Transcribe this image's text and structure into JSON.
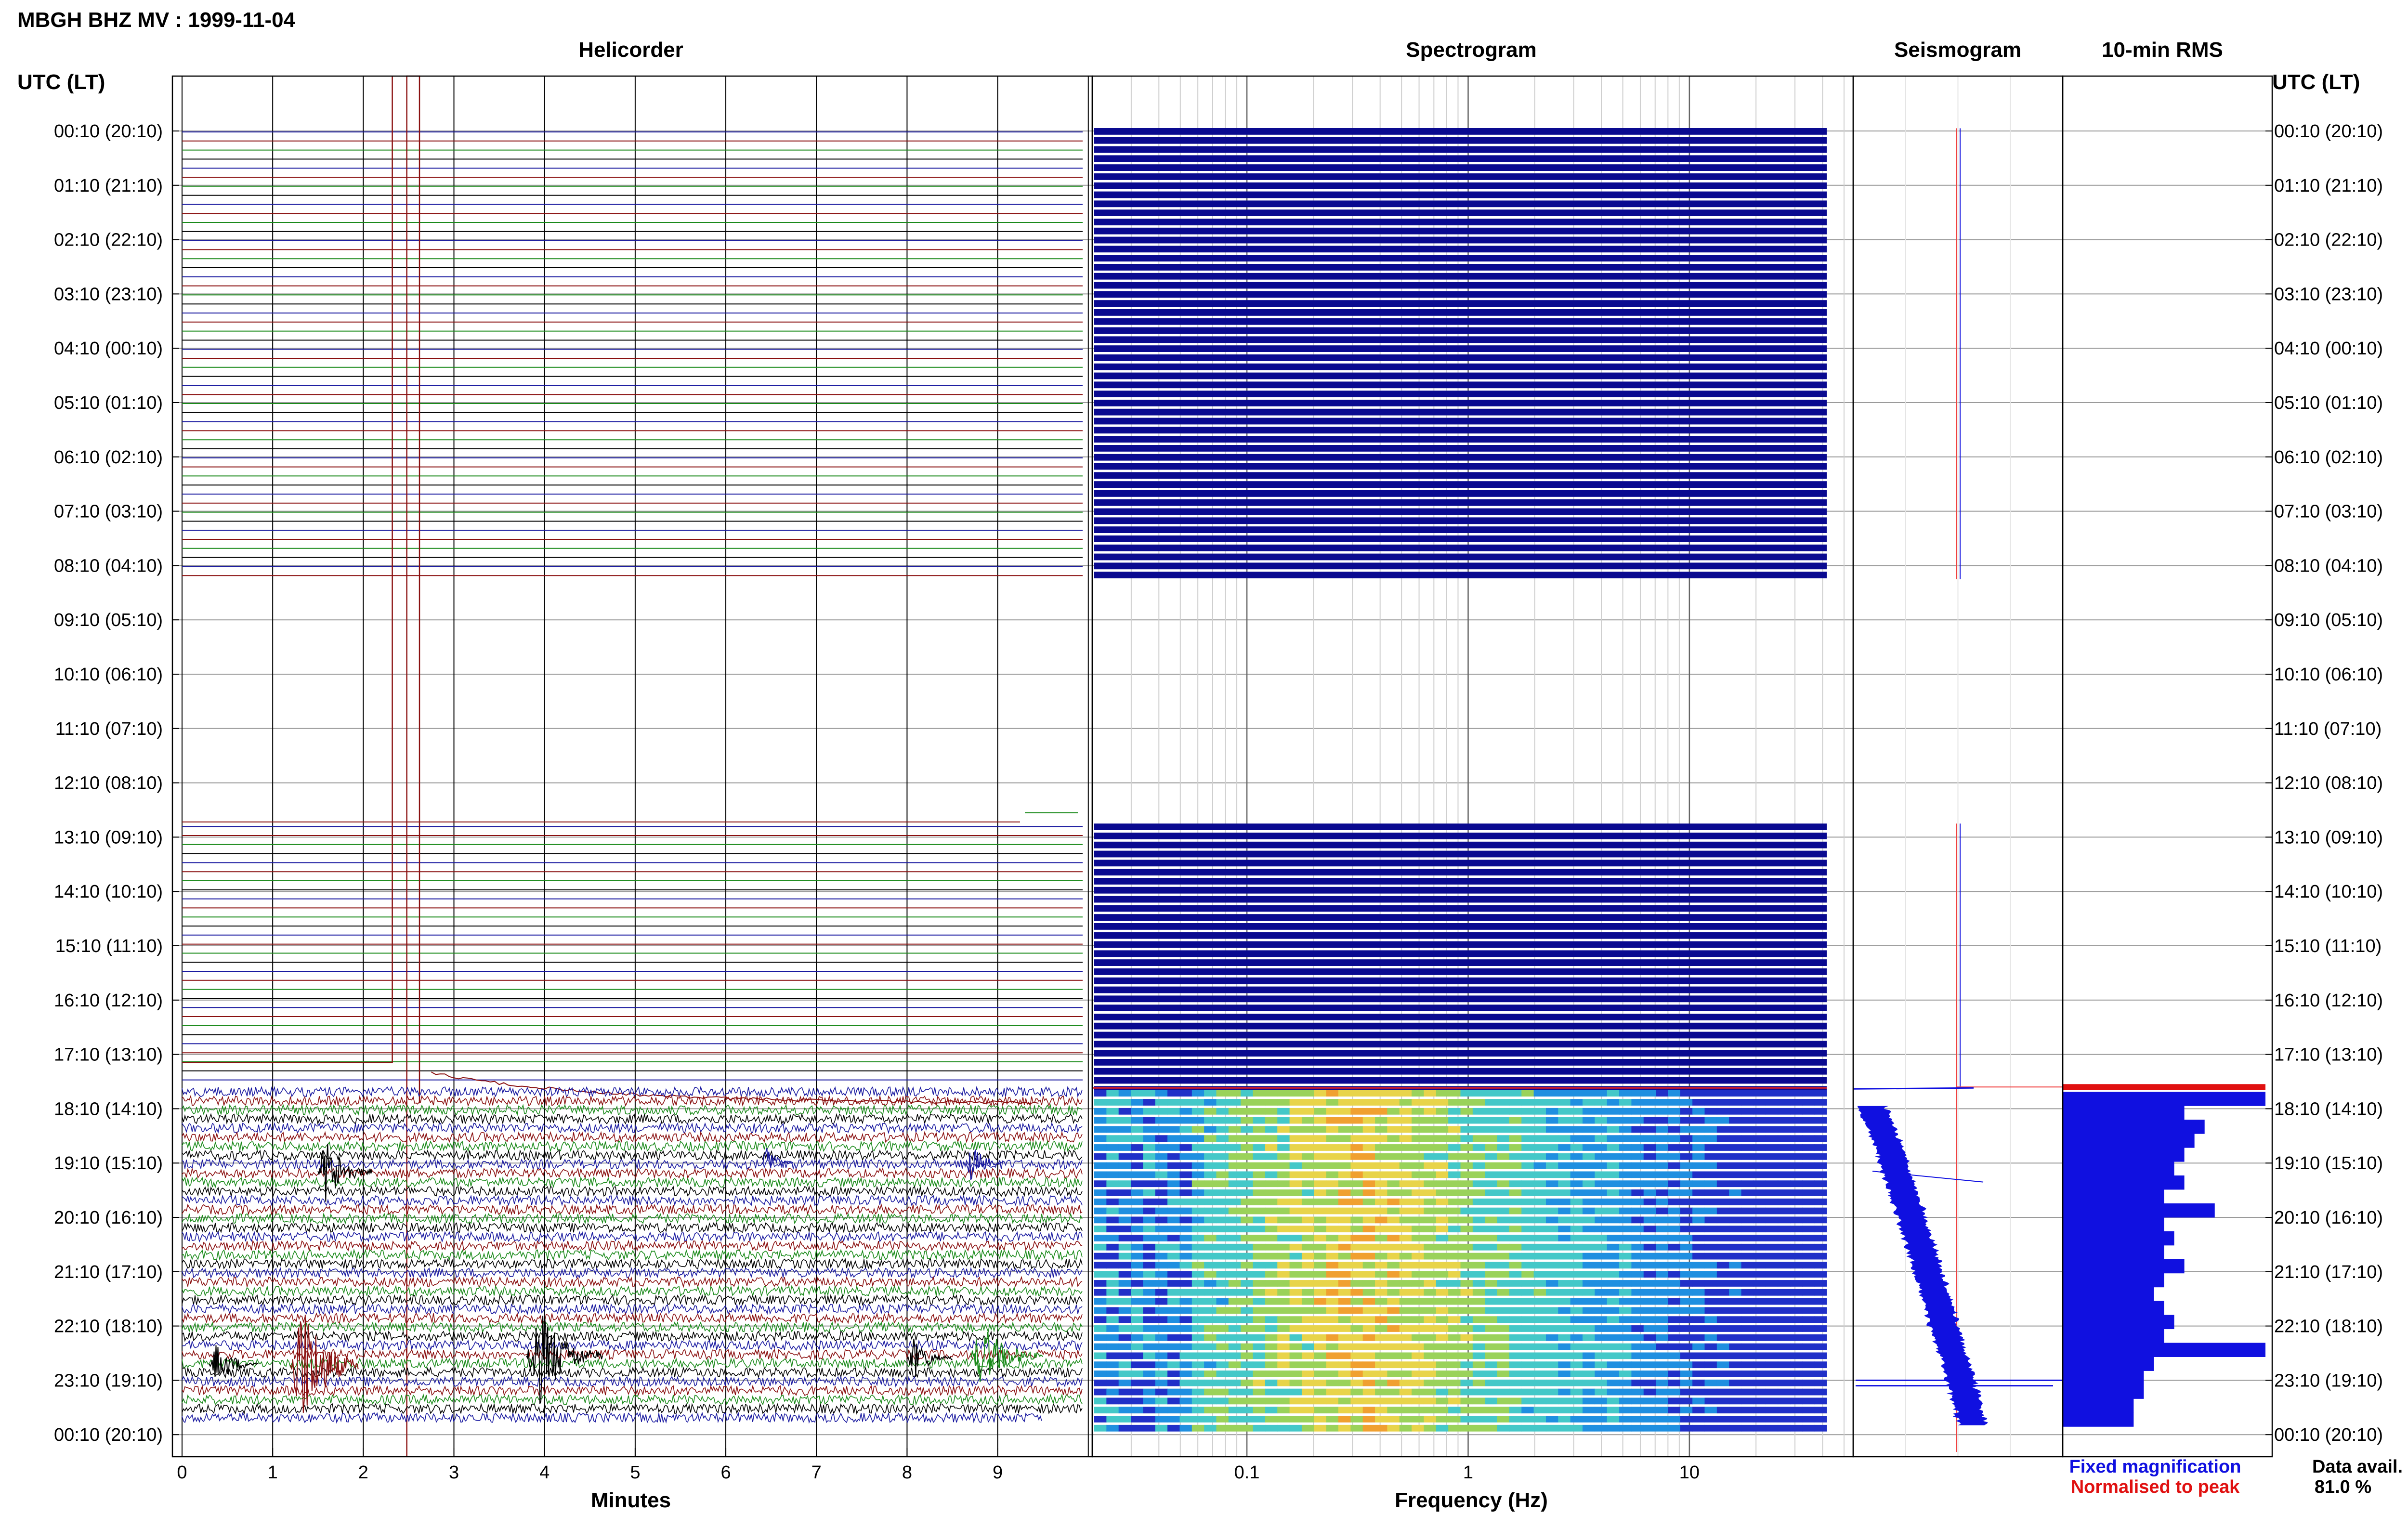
{
  "title": "MBGH BHZ MV : 1999-11-04",
  "panels": {
    "helicorder": "Helicorder",
    "spectrogram": "Spectrogram",
    "seismogram": "Seismogram",
    "rms": "10-min RMS"
  },
  "time_axis_label_left": "UTC (LT)",
  "time_axis_label_right": "UTC (LT)",
  "time_labels": [
    "00:10 (20:10)",
    "01:10 (21:10)",
    "02:10 (22:10)",
    "03:10 (23:10)",
    "04:10 (00:10)",
    "05:10 (01:10)",
    "06:10 (02:10)",
    "07:10 (03:10)",
    "08:10 (04:10)",
    "09:10 (05:10)",
    "10:10 (06:10)",
    "11:10 (07:10)",
    "12:10 (08:10)",
    "13:10 (09:10)",
    "14:10 (10:10)",
    "15:10 (11:10)",
    "16:10 (12:10)",
    "17:10 (13:10)",
    "18:10 (14:10)",
    "19:10 (15:10)",
    "20:10 (16:10)",
    "21:10 (17:10)",
    "22:10 (18:10)",
    "23:10 (19:10)",
    "00:10 (20:10)"
  ],
  "helicorder_xlabel": "Minutes",
  "helicorder_ticks": [
    "0",
    "1",
    "2",
    "3",
    "4",
    "5",
    "6",
    "7",
    "8",
    "9"
  ],
  "spectrogram_xlabel": "Frequency (Hz)",
  "spectrogram_ticks": [
    "0.1",
    "1",
    "10"
  ],
  "legend": {
    "fixed": "Fixed magnification",
    "normalised": "Normalised to peak",
    "avail_label": "Data avail.",
    "avail_value": "81.0 %"
  },
  "colors": {
    "trace_series": [
      "#1a1aa0",
      "#8a1010",
      "#1a8a1a",
      "#000000"
    ],
    "spectrogram_empty": "#0a0a90",
    "seismogram_fixed": "#1010e0",
    "seismogram_normalised": "#f04040",
    "rms_bar": "#1010e0",
    "rms_clipped": "#e01010"
  },
  "chart_data": {
    "type": "helicorder",
    "station": "MBGH BHZ MV",
    "date": "1999-11-04",
    "rows": 144,
    "row_minutes": 10,
    "x_minutes_range": [
      0,
      10
    ],
    "frequency_range_hz": [
      0.025,
      40
    ],
    "frequency_scale": "log",
    "data_gap_utc": [
      "08:20",
      "13:00"
    ],
    "active_signal_start_utc": "17:50",
    "events_minute": [
      0.3,
      1.2,
      1.5,
      3.8,
      6.4,
      8.0,
      8.7
    ],
    "rms_profile": [
      1.0,
      0.6,
      0.7,
      0.65,
      0.6,
      0.55,
      0.6,
      0.5,
      0.75,
      0.5,
      0.55,
      0.5,
      0.6,
      0.5,
      0.45,
      0.5,
      0.55,
      0.5,
      1.0,
      0.45,
      0.4,
      0.4,
      0.35,
      0.35
    ],
    "data_availability_percent": 81.0
  }
}
